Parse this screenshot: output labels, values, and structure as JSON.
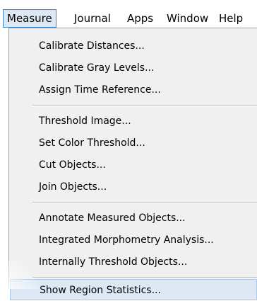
{
  "menubar": {
    "items": [
      {
        "label": "Measure"
      },
      {
        "label": "Journal"
      },
      {
        "label": "Apps"
      },
      {
        "label": "Window"
      },
      {
        "label": "Help"
      }
    ]
  },
  "dropdown": {
    "groups": [
      [
        "Calibrate Distances...",
        "Calibrate Gray Levels...",
        "Assign Time Reference..."
      ],
      [
        "Threshold Image...",
        "Set Color Threshold...",
        "Cut Objects...",
        "Join Objects..."
      ],
      [
        "Annotate Measured Objects...",
        "Integrated Morphometry Analysis...",
        "Internally Threshold Objects..."
      ],
      [
        "Show Region Statistics..."
      ]
    ]
  }
}
